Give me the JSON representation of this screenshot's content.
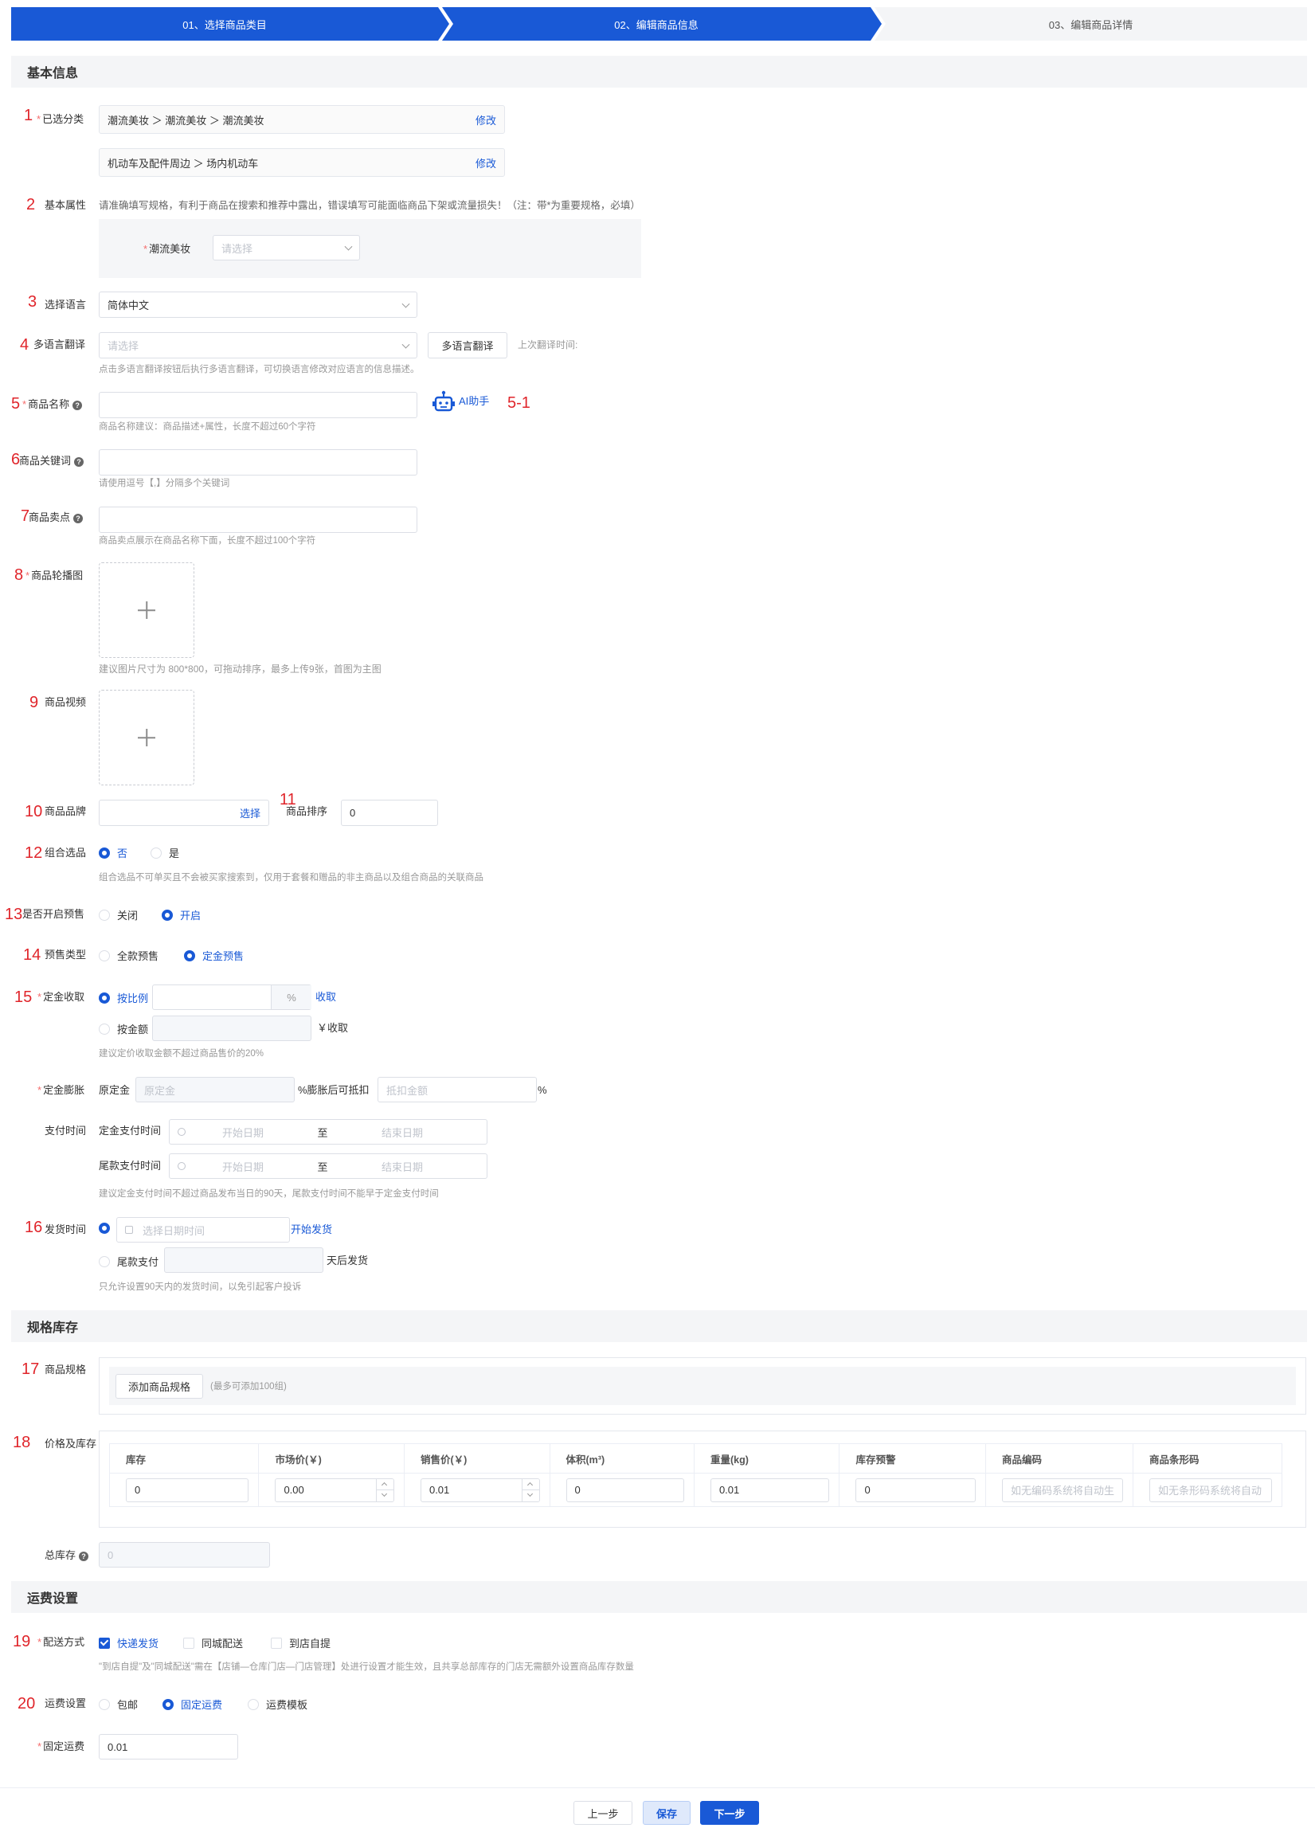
{
  "steps": [
    "01、选择商品类目",
    "02、编辑商品信息",
    "03、编辑商品详情"
  ],
  "sections": {
    "basic": "基本信息",
    "spec": "规格库存",
    "ship": "运费设置"
  },
  "ann": {
    "a1": "1",
    "a2": "2",
    "a3": "3",
    "a4": "4",
    "a5": "5",
    "a51": "5-1",
    "a6": "6",
    "a7": "7",
    "a8": "8",
    "a9": "9",
    "a10": "10",
    "a11": "11",
    "a12": "12",
    "a13": "13",
    "a14": "14",
    "a15": "15",
    "a16": "16",
    "a17": "17",
    "a18": "18",
    "a19": "19",
    "a20": "20"
  },
  "req": "*",
  "category": {
    "label": "已选分类",
    "row1": "潮流美妆 ＞ 潮流美妆 ＞ 潮流美妆",
    "row2": "机动车及配件周边 ＞ 场内机动车",
    "edit": "修改"
  },
  "attrs": {
    "label": "基本属性",
    "tip": "请准确填写规格，有利于商品在搜索和推荐中露出，错误填写可能面临商品下架或流量损失！（注：带*为重要规格，必填）",
    "field_label": "潮流美妆",
    "field_ph": "请选择"
  },
  "lang": {
    "label": "选择语言",
    "value": "简体中文"
  },
  "translate": {
    "label": "多语言翻译",
    "ph": "请选择",
    "button": "多语言翻译",
    "last": "上次翻译时间:",
    "hint": "点击多语言翻译按钮后执行多语言翻译，可切换语言修改对应语言的信息描述。"
  },
  "name": {
    "label": "商品名称",
    "hint": "商品名称建议：商品描述+属性，长度不超过60个字符",
    "ai": "AI助手"
  },
  "keywords": {
    "label": "商品关键词",
    "hint": "请使用逗号【,】分隔多个关键词"
  },
  "selling": {
    "label": "商品卖点",
    "hint": "商品卖点展示在商品名称下面，长度不超过100个字符"
  },
  "carousel": {
    "label": "商品轮播图",
    "hint": "建议图片尺寸为 800*800，可拖动排序，最多上传9张，首图为主图"
  },
  "video": {
    "label": "商品视频"
  },
  "brand": {
    "label": "商品品牌",
    "select": "选择"
  },
  "sort": {
    "label": "商品排序",
    "value": "0"
  },
  "combo": {
    "label": "组合选品",
    "opt_no": "否",
    "opt_yes": "是",
    "hint": "组合选品不可单买且不会被买家搜索到，仅用于套餐和赠品的非主商品以及组合商品的关联商品"
  },
  "presale": {
    "label": "是否开启预售",
    "opt_off": "关闭",
    "opt_on": "开启"
  },
  "presale_type": {
    "label": "预售类型",
    "opt_full": "全款预售",
    "opt_deposit": "定金预售"
  },
  "deposit": {
    "label": "定金收取",
    "by_ratio": "按比例",
    "pct": "%",
    "collect": "收取",
    "by_amount": "按金额",
    "yen_collect": "￥收取",
    "hint": "建议定价收取金额不超过商品售价的20%"
  },
  "inflate": {
    "label": "定金膨胀",
    "orig": "原定金",
    "orig_ph": "原定金",
    "mid": "%膨胀后可抵扣",
    "deduct_ph": "抵扣金额",
    "pct": "%"
  },
  "paytime": {
    "label": "支付时间",
    "deposit_label": "定金支付时间",
    "final_label": "尾款支付时间",
    "start": "开始日期",
    "to": "至",
    "end": "结束日期",
    "hint": "建议定金支付时间不超过商品发布当日的90天，尾款支付时间不能早于定金支付时间"
  },
  "ship_time": {
    "label": "发货时间",
    "date_ph": "选择日期时间",
    "start_ship": "开始发货",
    "final_pay": "尾款支付",
    "after": "天后发货",
    "hint": "只允许设置90天内的发货时间，以免引起客户投诉"
  },
  "spec": {
    "label": "商品规格",
    "button": "添加商品规格",
    "note": "(最多可添加100组)"
  },
  "price": {
    "label": "价格及库存",
    "headers": [
      "库存",
      "市场价(￥)",
      "销售价(￥)",
      "体积(m³)",
      "重量(kg)",
      "库存预警",
      "商品编码",
      "商品条形码"
    ],
    "values": [
      "0",
      "0.00",
      "0.01",
      "0",
      "0.01",
      "0"
    ],
    "code_ph": "如无编码系统将自动生",
    "barcode_ph": "如无条形码系统将自动"
  },
  "total": {
    "label": "总库存",
    "value": "0"
  },
  "delivery": {
    "label": "配送方式",
    "express": "快递发货",
    "city": "同城配送",
    "pickup": "到店自提",
    "hint": "\"到店自提\"及\"同城配送\"需在【店铺—仓库门店—门店管理】处进行设置才能生效，且共享总部库存的门店无需额外设置商品库存数量"
  },
  "freight": {
    "label": "运费设置",
    "free": "包邮",
    "fixed": "固定运费",
    "template": "运费模板"
  },
  "fixed_fee": {
    "label": "固定运费",
    "value": "0.01"
  },
  "footer": {
    "prev": "上一步",
    "save": "保存",
    "next": "下一步"
  },
  "colors": {
    "primary": "#1959d6",
    "annotation": "#e0252b",
    "required": "#f56c6c"
  }
}
